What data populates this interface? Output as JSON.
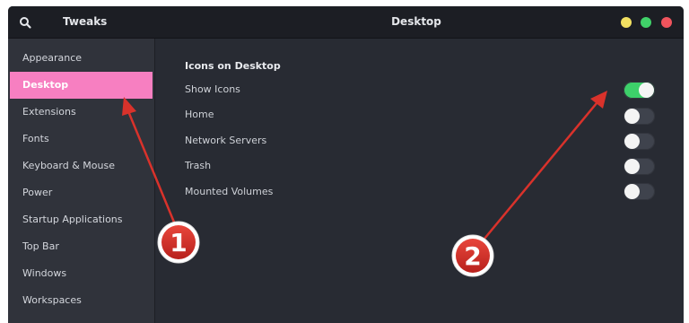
{
  "titlebar": {
    "app_title": "Tweaks",
    "page_title": "Desktop",
    "buttons": {
      "minimize_color": "#f2e061",
      "maximize_color": "#40d169",
      "close_color": "#f0545d"
    }
  },
  "sidebar": {
    "items": [
      {
        "label": "Appearance",
        "active": false
      },
      {
        "label": "Desktop",
        "active": true
      },
      {
        "label": "Extensions",
        "active": false
      },
      {
        "label": "Fonts",
        "active": false
      },
      {
        "label": "Keyboard & Mouse",
        "active": false
      },
      {
        "label": "Power",
        "active": false
      },
      {
        "label": "Startup Applications",
        "active": false
      },
      {
        "label": "Top Bar",
        "active": false
      },
      {
        "label": "Windows",
        "active": false
      },
      {
        "label": "Workspaces",
        "active": false
      }
    ]
  },
  "main": {
    "section_title": "Icons on Desktop",
    "settings": [
      {
        "label": "Show Icons",
        "enabled": true
      },
      {
        "label": "Home",
        "enabled": false
      },
      {
        "label": "Network Servers",
        "enabled": false
      },
      {
        "label": "Trash",
        "enabled": false
      },
      {
        "label": "Mounted Volumes",
        "enabled": false
      }
    ]
  },
  "annotations": {
    "marker_1": "1",
    "marker_2": "2",
    "color": "#d9322b"
  },
  "colors": {
    "accent": "#f77fc1",
    "toggle_on": "#3dd06a"
  }
}
